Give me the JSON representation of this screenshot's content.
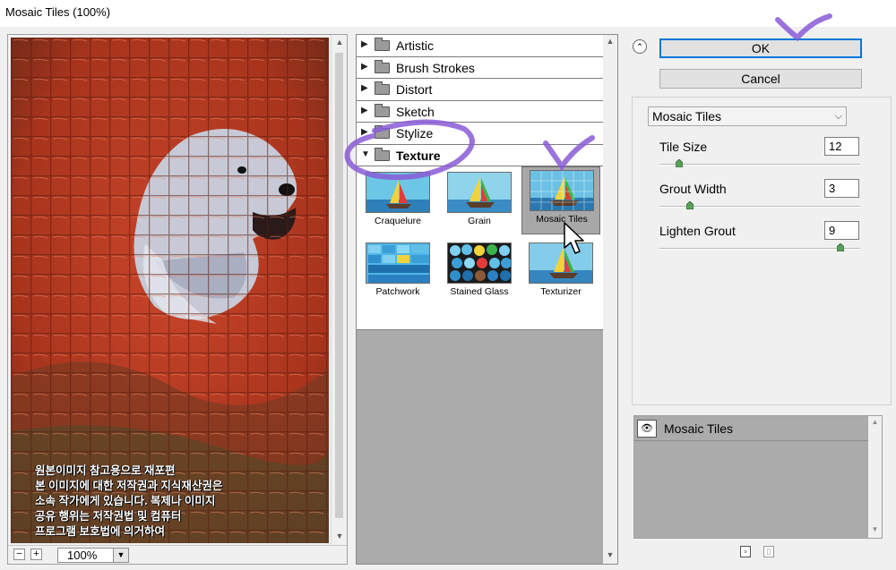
{
  "window": {
    "title": "Mosaic Tiles (100%)"
  },
  "preview": {
    "caption_lines": [
      "원본이미지 참고용으로 재포편",
      "본 이미지에 대한 저작권과 지식재산권은",
      "소속 작가에게 있습니다. 복제나 이미지",
      "공유 행위는 저작권법 및 컴퓨터",
      "프로그램 보호법에 의거하여"
    ],
    "zoom": "100%",
    "zoom_minus": "−",
    "zoom_plus": "+"
  },
  "browser": {
    "categories": [
      "Artistic",
      "Brush Strokes",
      "Distort",
      "Sketch",
      "Stylize",
      "Texture"
    ],
    "open_category": "Texture",
    "filters": [
      "Craquelure",
      "Grain",
      "Mosaic Tiles",
      "Patchwork",
      "Stained Glass",
      "Texturizer"
    ],
    "selected_filter": "Mosaic Tiles"
  },
  "actions": {
    "ok": "OK",
    "cancel": "Cancel"
  },
  "settings": {
    "filter_name": "Mosaic Tiles",
    "params": [
      {
        "label": "Tile Size",
        "value": "12",
        "level": 0.1
      },
      {
        "label": "Grout Width",
        "value": "3",
        "level": 0.15
      },
      {
        "label": "Lighten Grout",
        "value": "9",
        "level": 0.9
      }
    ]
  },
  "layers": {
    "items": [
      "Mosaic Tiles"
    ]
  },
  "colors": {
    "accent": "#0078d7",
    "annotation": "#8a5bd6",
    "panel_gray": "#ababab"
  }
}
